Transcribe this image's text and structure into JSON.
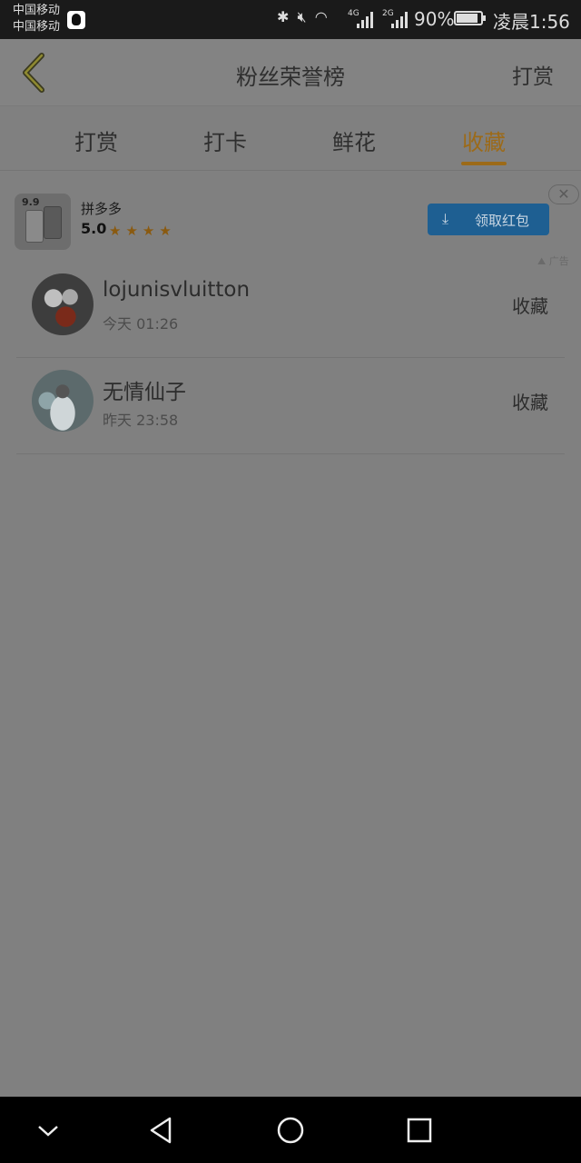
{
  "status_bar": {
    "carrier_1": "中国移动",
    "carrier_2": "中国移动",
    "network_1": "4G",
    "network_2": "2G",
    "battery_percent": "90%",
    "battery_level": 0.9,
    "time": "凌晨1:56",
    "icons": [
      "bluetooth-icon",
      "mute-icon",
      "wifi-icon",
      "signal-icon",
      "battery-icon"
    ]
  },
  "header": {
    "title": "粉丝荣誉榜",
    "action_label": "打赏",
    "back_icon": "chevron-left-icon"
  },
  "tabs": [
    {
      "label": "打赏",
      "active": false
    },
    {
      "label": "打卡",
      "active": false
    },
    {
      "label": "鲜花",
      "active": false
    },
    {
      "label": "收藏",
      "active": true
    }
  ],
  "ad": {
    "app_name": "拼多多",
    "icon_tag": "9.9",
    "rating": "5.0",
    "stars": "★★★★",
    "button_label": "领取红包",
    "close_icon": "close-icon",
    "ad_mark": "广告"
  },
  "list": [
    {
      "name": "lojunisvluitton",
      "time": "今天 01:26",
      "action": "收藏"
    },
    {
      "name": "无情仙子",
      "time": "昨天 23:58",
      "action": "收藏"
    }
  ],
  "nav_bar": [
    "collapse-chevron-icon",
    "back-triangle-icon",
    "home-circle-icon",
    "recents-square-icon"
  ],
  "colors": {
    "overlay_gray": "#808080",
    "active_tab": "#9c6a18",
    "ad_button": "#1e5f92"
  }
}
